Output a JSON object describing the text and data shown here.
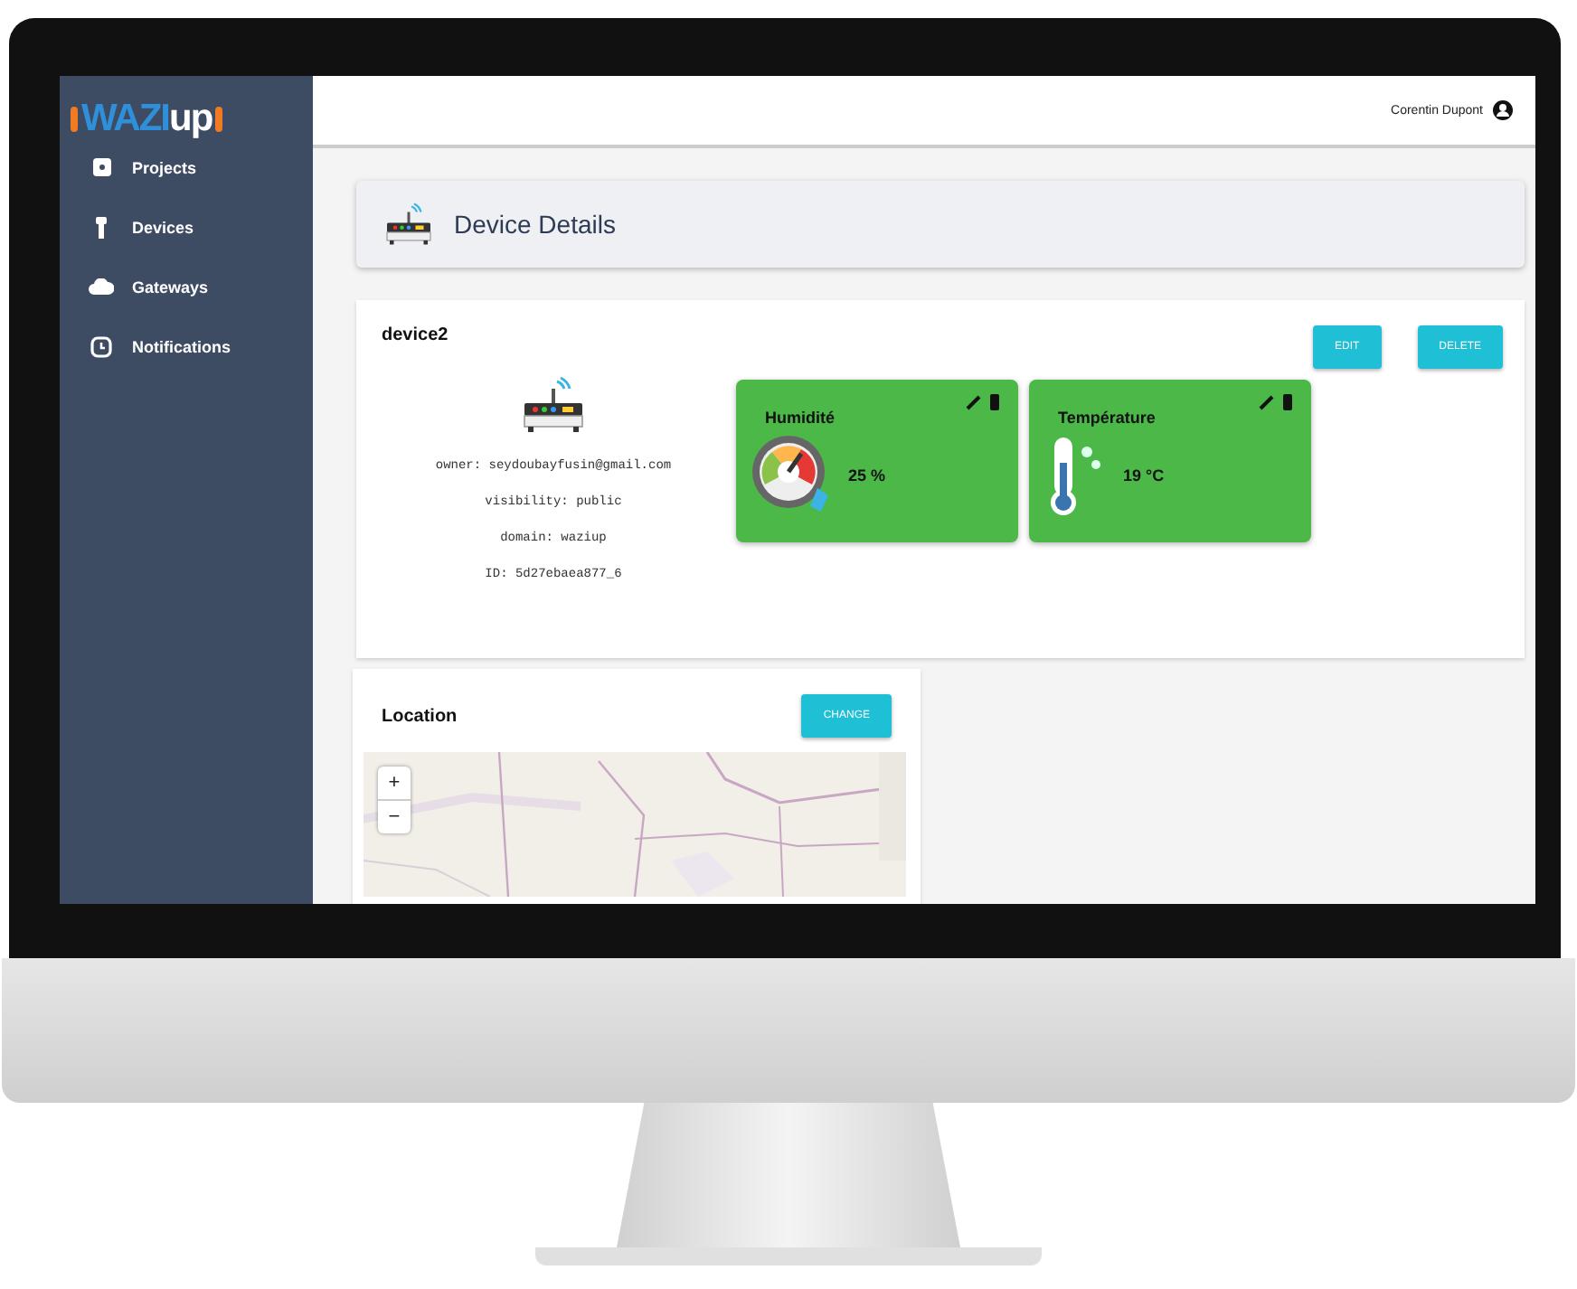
{
  "sidebar": {
    "logo": [
      "WAZI",
      "up"
    ],
    "items": [
      {
        "label": "Projects"
      },
      {
        "label": "Devices"
      },
      {
        "label": "Gateways"
      },
      {
        "label": "Notifications"
      }
    ]
  },
  "top_bar": {
    "user": "Corentin Dupont"
  },
  "page_header": {
    "title": "Device Details"
  },
  "device": {
    "name": "device2",
    "buttons": [
      "EDIT",
      "DELETE"
    ],
    "info": [
      "owner: seydoubayfusin@gmail.com",
      "visibility: public",
      "domain: waziup",
      "ID: 5d27ebaea877_6"
    ],
    "sensors": [
      {
        "kind": "humidity",
        "name": "Humidité",
        "value": "25 %"
      },
      {
        "kind": "temperature",
        "name": "Température",
        "value": "19 °C"
      }
    ]
  },
  "location": {
    "title": "Location",
    "button": "CHANGE",
    "map": {
      "zoom_in": "+",
      "zoom_out": "−"
    }
  }
}
